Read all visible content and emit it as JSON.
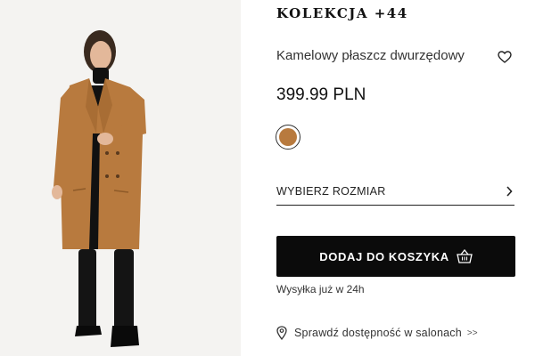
{
  "product": {
    "collection": "KOLEKCJA +44",
    "name": "Kamelowy płaszcz dwurzędowy",
    "price": "399.99 PLN",
    "color_swatch": "#b87a3e",
    "size_label": "WYBIERZ ROZMIAR",
    "cart_label": "DODAJ DO KOSZYKA",
    "shipping": "Wysyłka już w 24h",
    "stores_label": "Sprawdź dostępność w salonach",
    "stores_arrow": ">>"
  },
  "colors": {
    "accent": "#0b0b0b",
    "coat": "#b87a3e",
    "background": "#f4f3f1"
  },
  "icons": [
    "heart-icon",
    "chevron-right-icon",
    "basket-icon",
    "location-pin-icon"
  ]
}
